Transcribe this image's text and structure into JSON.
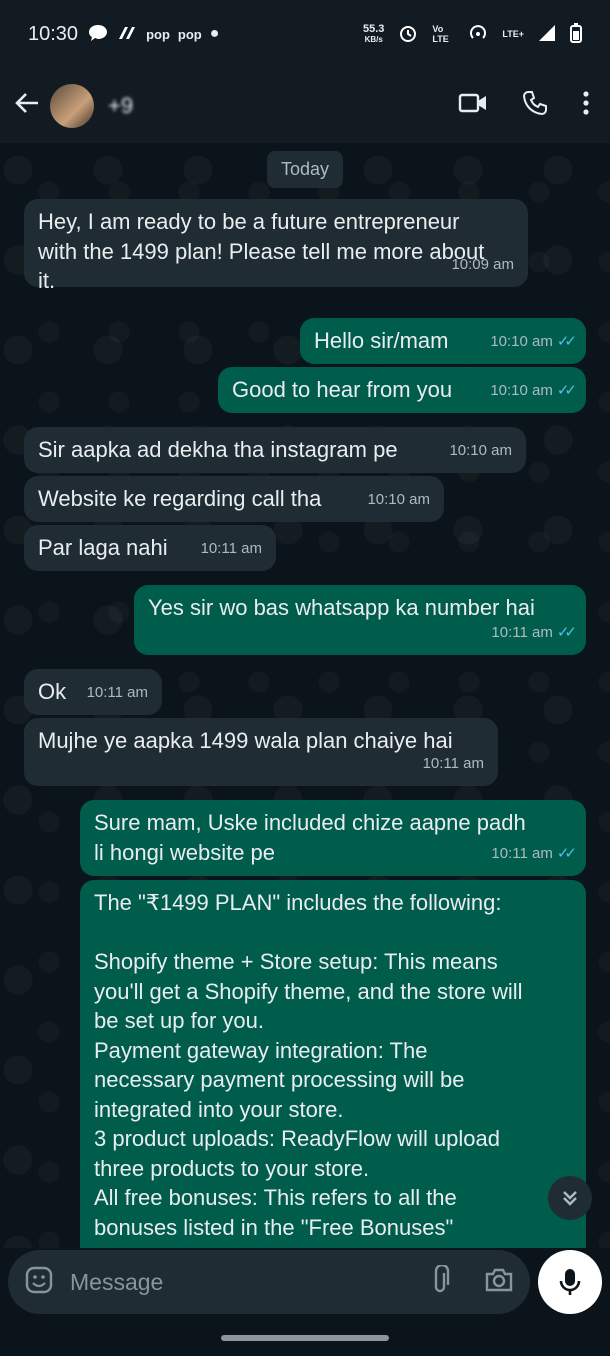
{
  "status_bar": {
    "time": "10:30",
    "left_icons": [
      "chat-bubble-icon",
      "signal-app-icon",
      "pop pop",
      "pop pop"
    ],
    "pop1": "pop",
    "pop2": "pop",
    "net_speed": "55.3",
    "net_speed_unit": "KB/s",
    "volte": "Vo LTE",
    "lte": "LTE+"
  },
  "header": {
    "contact_name": "+9",
    "icons": [
      "back-arrow-icon",
      "video-call-icon",
      "phone-icon",
      "more-vert-icon"
    ]
  },
  "chat": {
    "date_chip": "Today",
    "messages": [
      {
        "dir": "in",
        "text": "Hey, I am ready to be a future entrepreneur\nwith the 1499 plan! Please tell me more about\nit.",
        "time": "10:09 am"
      },
      {
        "dir": "out",
        "text": "Hello sir/mam",
        "time": "10:10 am",
        "read": true
      },
      {
        "dir": "out",
        "text": "Good to hear from you",
        "time": "10:10 am",
        "read": true
      },
      {
        "dir": "in",
        "text": "Sir aapka ad dekha tha instagram pe",
        "time": "10:10 am"
      },
      {
        "dir": "in",
        "text": "Website ke regarding call tha",
        "time": "10:10 am"
      },
      {
        "dir": "in",
        "text": "Par laga nahi",
        "time": "10:11 am"
      },
      {
        "dir": "out",
        "text": "Yes sir wo bas whatsapp ka number hai",
        "time": "10:11 am",
        "read": true
      },
      {
        "dir": "in",
        "text": "Ok",
        "time": "10:11 am"
      },
      {
        "dir": "in",
        "text": "Mujhe ye aapka 1499 wala plan chaiye hai",
        "time": "10:11 am"
      },
      {
        "dir": "out",
        "text": "Sure mam, Uske included chize aapne padh\nli hongi website pe",
        "time": "10:11 am",
        "read": true
      },
      {
        "dir": "out",
        "text": "The \"₹1499 PLAN\" includes the following:\n\nShopify theme + Store setup: This means\nyou'll get a Shopify theme, and the store will\nbe set up for you.\nPayment gateway integration: The\nnecessary payment processing will be\nintegrated into your store.\n3 product uploads: ReadyFlow will upload\nthree products to your store.\nAll free bonuses: This refers to all the\nbonuses listed in the \"Free Bonuses\""
      }
    ]
  },
  "composer": {
    "placeholder": "Message",
    "icons": [
      "emoji-icon",
      "attach-icon",
      "camera-icon",
      "mic-icon"
    ]
  },
  "colors": {
    "background": "#0b141a",
    "incoming": "#202c33",
    "outgoing": "#005c4b",
    "read_ticks": "#53bdeb"
  }
}
